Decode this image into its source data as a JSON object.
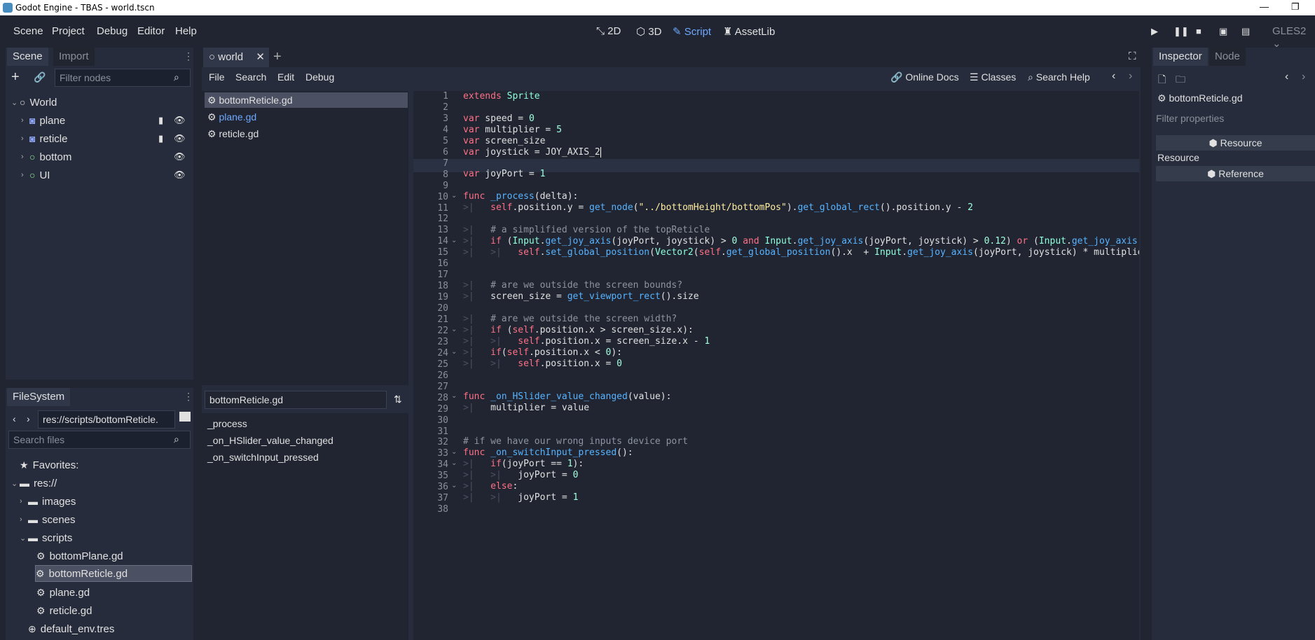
{
  "window": {
    "title": "Godot Engine - TBAS - world.tscn",
    "minimize": "—",
    "restore": "❐"
  },
  "menu": {
    "items": [
      "Scene",
      "Project",
      "Debug",
      "Editor",
      "Help"
    ]
  },
  "workspaces": {
    "w2d": "2D",
    "w3d": "3D",
    "script": "Script",
    "assetlib": "AssetLib"
  },
  "renderer": "GLES2",
  "scene_dock": {
    "tabs": [
      "Scene",
      "Import"
    ],
    "filter_placeholder": "Filter nodes",
    "nodes": [
      "World",
      "plane",
      "reticle",
      "bottom",
      "UI"
    ]
  },
  "filesystem": {
    "tab": "FileSystem",
    "path": "res://scripts/bottomReticle.",
    "search_placeholder": "Search files",
    "favorites": "Favorites:",
    "root": "res://",
    "folders": [
      "images",
      "scenes",
      "scripts"
    ],
    "scripts": [
      "bottomPlane.gd",
      "bottomReticle.gd",
      "plane.gd",
      "reticle.gd"
    ],
    "env": "default_env.tres"
  },
  "editor_tabs": {
    "world": "world"
  },
  "script_menu": {
    "file": "File",
    "search": "Search",
    "edit": "Edit",
    "debug": "Debug",
    "online_docs": "Online Docs",
    "classes": "Classes",
    "search_help": "Search Help"
  },
  "script_list": [
    "bottomReticle.gd",
    "plane.gd",
    "reticle.gd"
  ],
  "method_filter": "bottomReticle.gd",
  "methods": [
    "_process",
    "_on_HSlider_value_changed",
    "_on_switchInput_pressed"
  ],
  "inspector": {
    "tabs": [
      "Inspector",
      "Node"
    ],
    "file": "bottomReticle.gd",
    "filter_placeholder": "Filter properties",
    "resource_btn": "Resource",
    "resource_label": "Resource",
    "reference_btn": "Reference"
  },
  "code_line_count": 38
}
